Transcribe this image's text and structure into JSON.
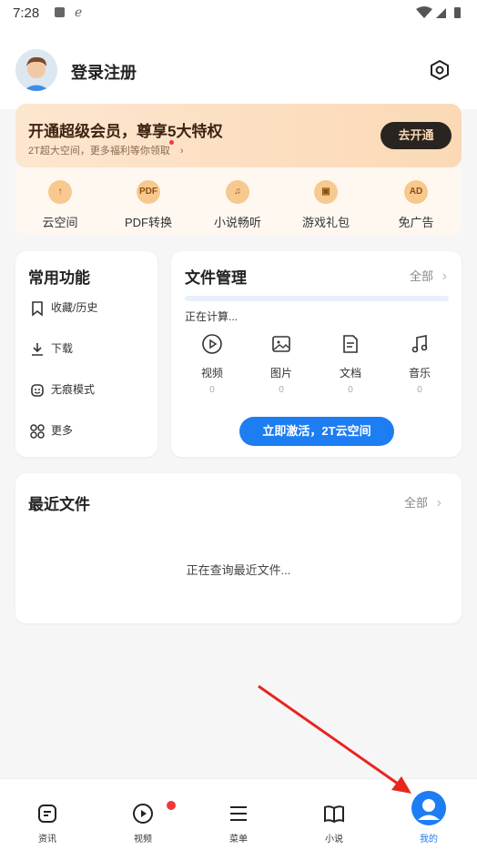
{
  "status": {
    "time": "7:28"
  },
  "user": {
    "login_label": "登录注册"
  },
  "vip": {
    "title": "开通超级会员，尊享5大特权",
    "subtitle": "2T超大空间，更多福利等你领取",
    "button": "去开通",
    "benefits": [
      {
        "label": "云空间",
        "icon": "cloud-icon",
        "glyph": "↑"
      },
      {
        "label": "PDF转换",
        "icon": "pdf-icon",
        "glyph": "PDF"
      },
      {
        "label": "小说畅听",
        "icon": "headphones-icon",
        "glyph": "♫"
      },
      {
        "label": "游戏礼包",
        "icon": "gift-icon",
        "glyph": "▣"
      },
      {
        "label": "免广告",
        "icon": "no-ad-icon",
        "glyph": "AD"
      }
    ]
  },
  "common": {
    "title": "常用功能",
    "items": [
      {
        "label": "收藏/历史",
        "icon": "bookmark-icon"
      },
      {
        "label": "下载",
        "icon": "download-icon"
      },
      {
        "label": "无痕模式",
        "icon": "incognito-icon"
      },
      {
        "label": "更多",
        "icon": "grid-icon"
      }
    ]
  },
  "files": {
    "title": "文件管理",
    "all_label": "全部",
    "status": "正在计算...",
    "types": [
      {
        "label": "视频",
        "count": "0",
        "icon": "video-icon"
      },
      {
        "label": "图片",
        "count": "0",
        "icon": "image-icon"
      },
      {
        "label": "文档",
        "count": "0",
        "icon": "document-icon"
      },
      {
        "label": "音乐",
        "count": "0",
        "icon": "music-icon"
      }
    ],
    "activate_button": "立即激活，2T云空间"
  },
  "recent": {
    "title": "最近文件",
    "all_label": "全部",
    "message": "正在查询最近文件..."
  },
  "tabs": [
    {
      "label": "资讯",
      "icon": "news-icon"
    },
    {
      "label": "视频",
      "icon": "play-icon"
    },
    {
      "label": "菜单",
      "icon": "menu-icon"
    },
    {
      "label": "小说",
      "icon": "book-icon"
    },
    {
      "label": "我的",
      "icon": "profile-icon",
      "active": true
    }
  ],
  "colors": {
    "accent": "#1d7df2",
    "vip_button": "#2a2420",
    "annotation_arrow": "#e8261f"
  }
}
